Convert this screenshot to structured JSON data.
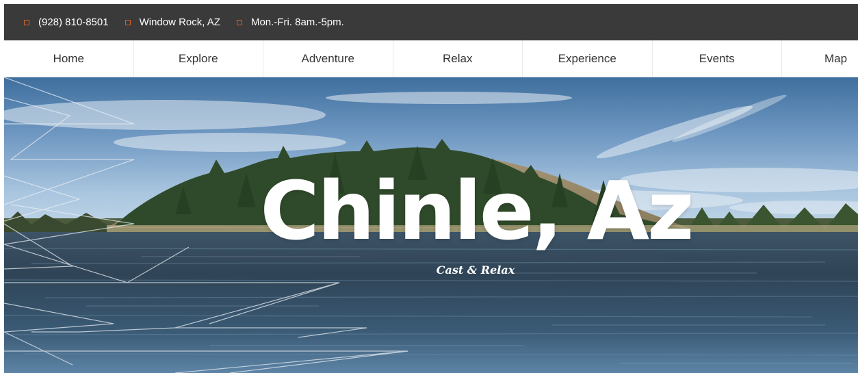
{
  "topbar": {
    "phone": {
      "icon": "phone-icon",
      "text": "(928) 810-8501"
    },
    "location": {
      "icon": "location-icon",
      "text": "Window Rock, AZ"
    },
    "hours": {
      "icon": "clock-icon",
      "text": "Mon.-Fri. 8am.-5pm."
    },
    "icon_color": "#d4622a",
    "background": "#3a3a3a"
  },
  "nav": {
    "items": [
      {
        "label": "Home"
      },
      {
        "label": "Explore"
      },
      {
        "label": "Adventure"
      },
      {
        "label": "Relax"
      },
      {
        "label": "Experience"
      },
      {
        "label": "Events"
      },
      {
        "label": "Map"
      }
    ]
  },
  "hero": {
    "title": "Chinle, Az",
    "subtitle": "Cast & Relax"
  }
}
